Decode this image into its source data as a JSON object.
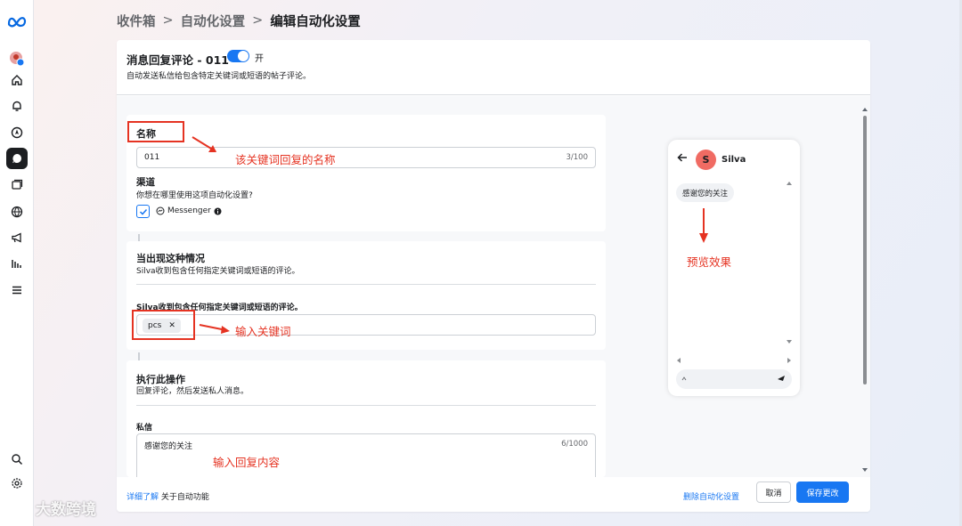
{
  "breadcrumb": {
    "items": [
      "收件箱",
      "自动化设置",
      "编辑自动化设置"
    ],
    "separator": ">"
  },
  "header": {
    "title": "消息回复评论 - 011",
    "toggle_label": "开",
    "toggle_on": true,
    "subtitle": "自动发送私信给包含特定关键词或短语的帖子评论。"
  },
  "name_section": {
    "label": "名称",
    "value": "011",
    "counter": "3/100",
    "channel_label": "渠道",
    "channel_question": "你想在哪里使用这项自动化设置?",
    "channel_option": "Messenger",
    "channel_checked": true
  },
  "trigger_section": {
    "title": "当出现这种情况",
    "description": "Silva收到包含任何指定关键词或短语的评论。",
    "field_label": "Silva收到包含任何指定关键词或短语的评论。",
    "keyword_tag": "pcs",
    "remove_symbol": "✕"
  },
  "action_section": {
    "title": "执行此操作",
    "description": "回复评论，然后发送私人消息。",
    "field_label": "私信",
    "message_value": "感谢您的关注",
    "counter": "6/1000"
  },
  "preview": {
    "avatar_letter": "S",
    "contact_name": "Silva",
    "message": "感谢您的关注"
  },
  "footer": {
    "learn_link": "详细了解",
    "learn_text": "关于自动功能",
    "delete_link": "删除自动化设置",
    "cancel_label": "取消",
    "save_label": "保存更改"
  },
  "annotations": {
    "name_note": "该关键词回复的名称",
    "keyword_note": "输入关键词",
    "preview_note": "预览效果",
    "content_note": "输入回复内容"
  },
  "watermark": "大数跨境",
  "colors": {
    "accent": "#1877f2",
    "annotation": "#e53322",
    "avatar": "#f06b63"
  }
}
